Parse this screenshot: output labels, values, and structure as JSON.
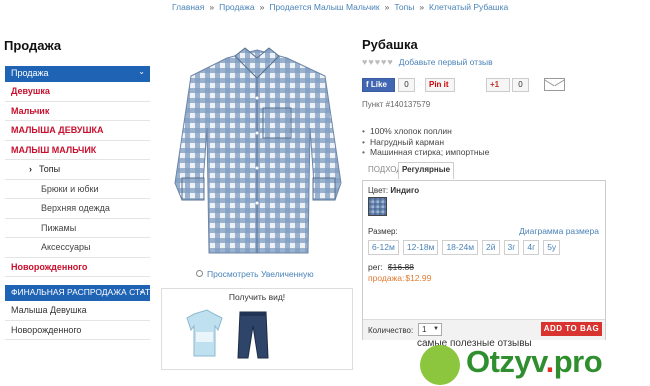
{
  "breadcrumb": [
    "Главная",
    "Продажа",
    "Продается Малыш Мальчик",
    "Топы",
    "Клетчатый Рубашка"
  ],
  "sidebar": {
    "title": "Продажа",
    "header": "Продажа",
    "items": [
      {
        "label": "Девушка",
        "style": "red"
      },
      {
        "label": "Мальчик",
        "style": "red"
      },
      {
        "label": "МАЛЫША ДЕВУШКА",
        "style": "red"
      },
      {
        "label": "МАЛЫШ МАЛЬЧИК",
        "style": "red"
      },
      {
        "label": "Топы",
        "style": "sub-active"
      },
      {
        "label": "Брюки и юбки",
        "style": "sub"
      },
      {
        "label": "Верхняя одежда",
        "style": "sub"
      },
      {
        "label": "Пижамы",
        "style": "sub"
      },
      {
        "label": "Аксессуары",
        "style": "sub"
      },
      {
        "label": "Новорожденного",
        "style": "red"
      }
    ],
    "header2": "ФИНАЛЬНАЯ РАСПРОДАЖА СТАТЕЙ",
    "items2": [
      {
        "label": "Малыша Девушка"
      },
      {
        "label": "Новорожденного"
      }
    ]
  },
  "product": {
    "title": "Рубашка",
    "review_link": "Добавьте первый отзыв",
    "social": {
      "like": "Like",
      "like_count": "0",
      "pin": "Pin it",
      "gplus": "+1",
      "gplus_count": "0"
    },
    "sku": "Пункт #140137579",
    "bullets": [
      "100% хлопок поплин",
      "Нагрудный карман",
      "Машинная стирка; импортные"
    ],
    "tabs": [
      "ПОДХОДЯЩИЙ",
      "Регулярные"
    ],
    "color_label": "Цвет:",
    "color_value": "Индиго",
    "size_label": "Размер:",
    "size_chart": "Диаграмма размера",
    "sizes": [
      "6-12м",
      "12-18м",
      "18-24м",
      "2й",
      "3г",
      "4г",
      "5у"
    ],
    "price_reg_label": "рег:",
    "price_reg": "$16.88",
    "price_sale_label": "продажа:",
    "price_sale": "$12.99",
    "qty_label": "Количество:",
    "qty_value": "1",
    "add_to_bag": "ADD TO BAG",
    "zoom": "Просмотреть Увеличенную",
    "also_title": "Получить вид!"
  },
  "watermark": {
    "tagline": "самые полезные отзывы",
    "brand": "Otzyv",
    "tld": "pro"
  },
  "colors": {
    "accent_blue": "#1f63b4",
    "link_blue": "#4a83b8",
    "sale_red": "#c8102e",
    "sale_orange": "#e07a2f",
    "add_bag_red": "#d8332f"
  }
}
